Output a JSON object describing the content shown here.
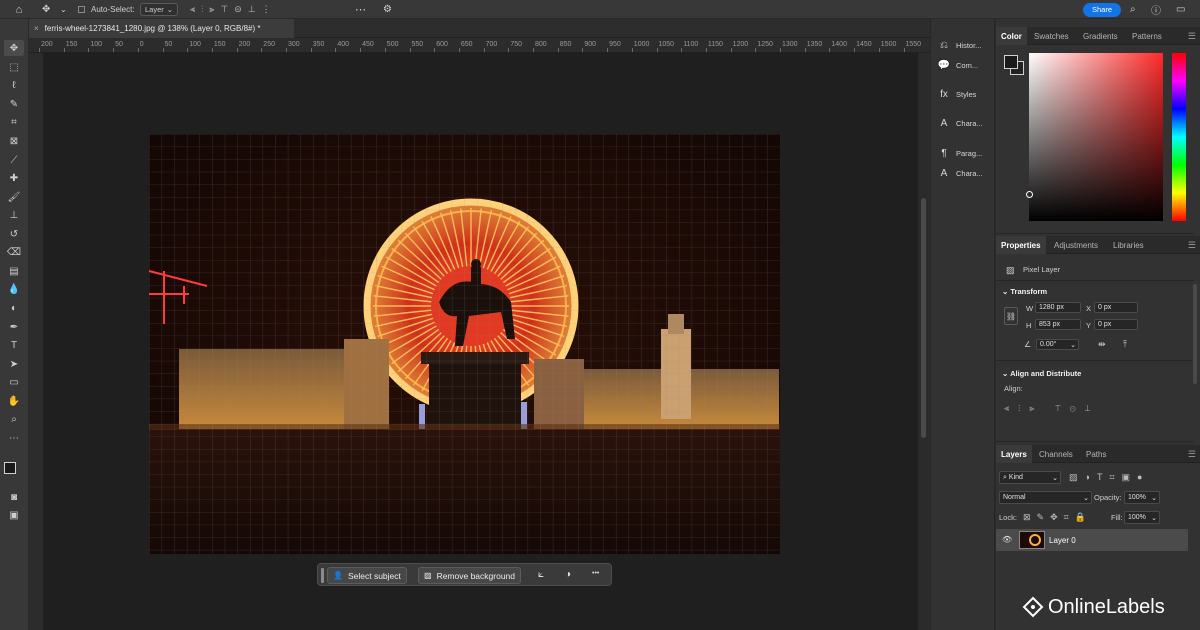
{
  "options_bar": {
    "home_icon": "home-icon",
    "auto_select_label": "Auto-Select:",
    "auto_select_value": "Layer",
    "share_label": "Share"
  },
  "document": {
    "tab_title": "ferris-wheel-1273841_1280.jpg @ 138% (Layer 0, RGB/8#) *",
    "close_glyph": "×"
  },
  "ruler": {
    "top_ticks": [
      "200",
      "150",
      "100",
      "50",
      "0",
      "50",
      "100",
      "150",
      "200",
      "250",
      "300",
      "350",
      "400",
      "450",
      "500",
      "550",
      "600",
      "650",
      "700",
      "750",
      "800",
      "850",
      "900",
      "950",
      "1000",
      "1050",
      "1100",
      "1150",
      "1200",
      "1250",
      "1300",
      "1350",
      "1400",
      "1450",
      "1500",
      "1550"
    ]
  },
  "context_bar": {
    "select_subject": "Select subject",
    "remove_background": "Remove background",
    "more": "•••"
  },
  "icon_strip": {
    "items": [
      {
        "label": "Histor...",
        "icon": "history-icon"
      },
      {
        "label": "Com...",
        "icon": "comments-icon"
      },
      {
        "label": "Styles",
        "icon": "styles-icon"
      },
      {
        "label": "Chara...",
        "icon": "character-icon"
      },
      {
        "label": "Parag...",
        "icon": "paragraph-icon"
      },
      {
        "label": "Chara...",
        "icon": "character-styles-icon"
      }
    ]
  },
  "color_panel": {
    "tabs": [
      "Color",
      "Swatches",
      "Gradients",
      "Patterns"
    ],
    "foreground": "#1a1a1a",
    "background": "#ffffff",
    "hue_color": "#ff2a2a"
  },
  "properties_panel": {
    "tabs": [
      "Properties",
      "Adjustments",
      "Libraries"
    ],
    "layer_type": "Pixel Layer",
    "transform_title": "Transform",
    "w_label": "W",
    "w_value": "1280 px",
    "h_label": "H",
    "h_value": "853 px",
    "x_label": "X",
    "x_value": "0 px",
    "y_label": "Y",
    "y_value": "0 px",
    "angle_value": "0.00°",
    "align_title": "Align and Distribute",
    "align_label": "Align:"
  },
  "layers_panel": {
    "tabs": [
      "Layers",
      "Channels",
      "Paths"
    ],
    "kind_label": "Kind",
    "blend_mode": "Normal",
    "opacity_label": "Opacity:",
    "opacity_value": "100%",
    "lock_label": "Lock:",
    "fill_label": "Fill:",
    "fill_value": "100%",
    "layer_name": "Layer 0"
  },
  "brand": {
    "name": "OnlineLabels"
  }
}
